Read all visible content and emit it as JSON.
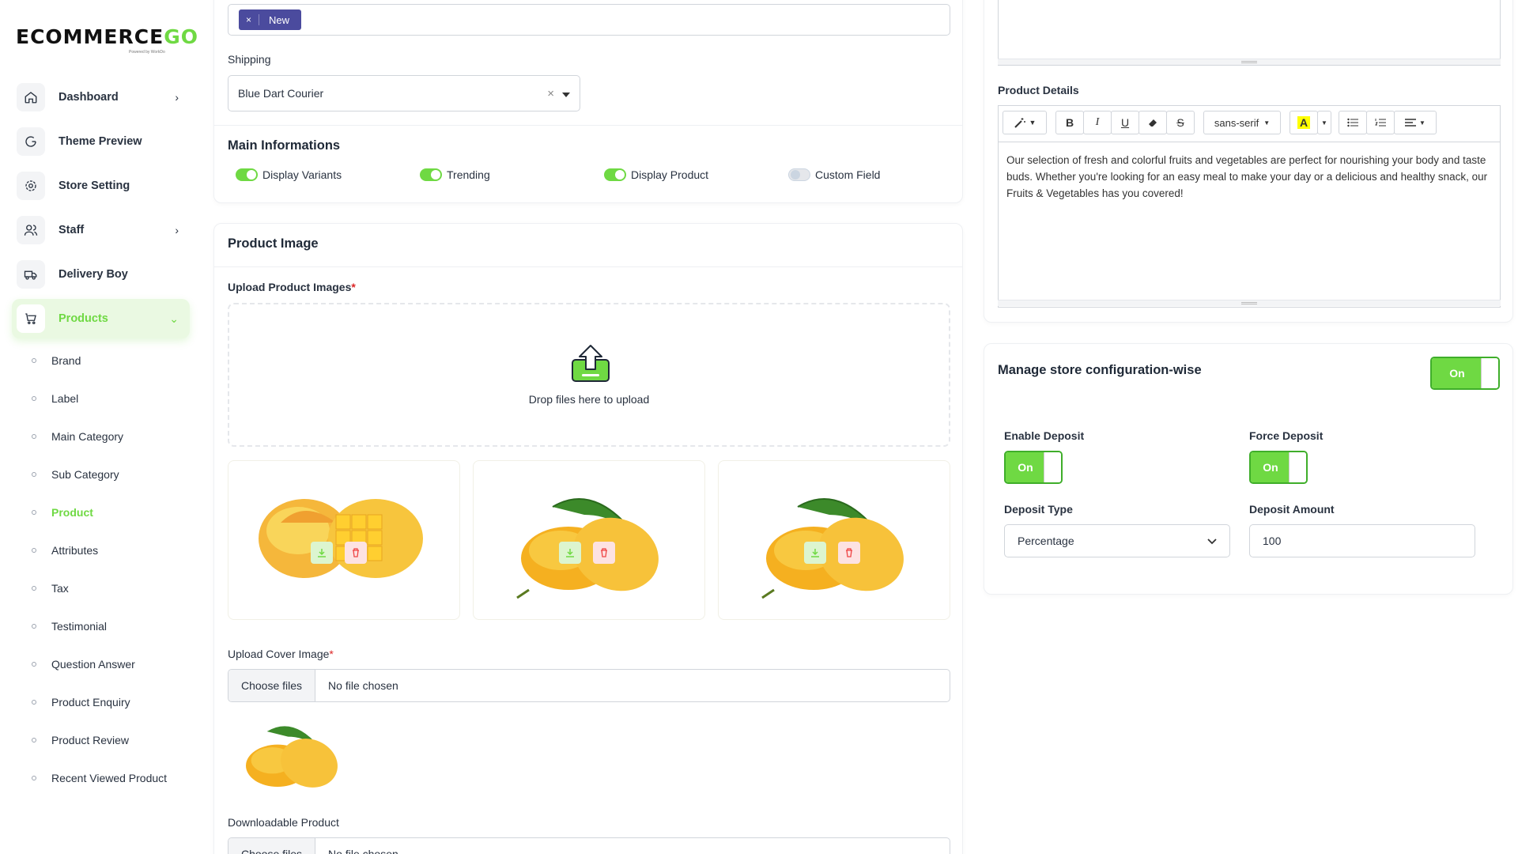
{
  "brand": {
    "logo_main": "ECOMMERCE",
    "logo_accent": "GO",
    "logo_sub": "Powered by WorkDo"
  },
  "sidebar": {
    "items": [
      {
        "label": "Dashboard",
        "icon": "home-icon",
        "chevron": "›"
      },
      {
        "label": "Theme Preview",
        "icon": "theme-preview-icon"
      },
      {
        "label": "Store Setting",
        "icon": "gear-icon"
      },
      {
        "label": "Staff",
        "icon": "users-icon",
        "chevron": "›"
      },
      {
        "label": "Delivery Boy",
        "icon": "truck-icon"
      },
      {
        "label": "Products",
        "icon": "cart-icon",
        "chevron": "⌄"
      }
    ],
    "sub_items": [
      "Brand",
      "Label",
      "Main Category",
      "Sub Category",
      "Product",
      "Attributes",
      "Tax",
      "Testimonial",
      "Question Answer",
      "Product Enquiry",
      "Product Review",
      "Recent Viewed Product"
    ]
  },
  "form": {
    "tag_remove": "×",
    "tag_label": "New",
    "shipping_label": "Shipping",
    "shipping_value": "Blue Dart Courier",
    "shipping_clear": "×",
    "main_info_title": "Main Informations",
    "switches": [
      {
        "label": "Display Variants",
        "on": true
      },
      {
        "label": "Trending",
        "on": true
      },
      {
        "label": "Display Product",
        "on": true
      },
      {
        "label": "Custom Field",
        "on": false
      }
    ],
    "product_image_title": "Product Image",
    "upload_images_label": "Upload Product Images",
    "required_mark": "*",
    "dropzone_text": "Drop files here to upload",
    "upload_cover_label": "Upload Cover Image",
    "choose_files": "Choose files",
    "no_file": "No file chosen",
    "downloadable_label": "Downloadable Product"
  },
  "details": {
    "title": "Product Details",
    "font_name": "sans-serif",
    "toolbar": {
      "bold": "B",
      "italic": "I",
      "underline": "U",
      "strike": "S",
      "color": "A"
    },
    "text": "Our selection of fresh and colorful fruits and vegetables are perfect for nourishing your body and taste buds. Whether you're looking for an easy meal to make your day or a delicious and healthy snack, our Fruits & Vegetables has you covered!"
  },
  "store_config": {
    "title": "Manage store configuration-wise",
    "toggle": "On",
    "enable_deposit_label": "Enable Deposit",
    "enable_deposit": "On",
    "force_deposit_label": "Force Deposit",
    "force_deposit": "On",
    "deposit_type_label": "Deposit Type",
    "deposit_type": "Percentage",
    "deposit_amount_label": "Deposit Amount",
    "deposit_amount": "100"
  },
  "colors": {
    "accent": "#6fd943",
    "tag": "#4b4b9e",
    "danger": "#ef4444"
  }
}
